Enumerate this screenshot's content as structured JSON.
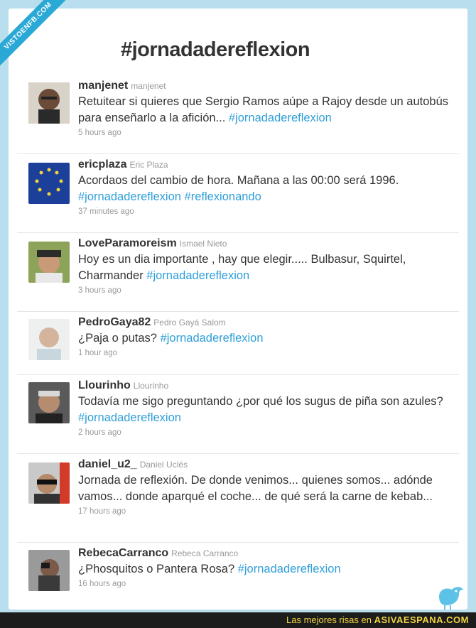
{
  "ribbon": "VISTOENFB.COM",
  "title": "#jornadadereflexion",
  "tweets": [
    {
      "user": "manjenet",
      "real": "manjenet",
      "text": "Retuitear si quieres que Sergio Ramos aúpe a Rajoy desde un autobús para enseñarlo a la afición... ",
      "tags": "#jornadadereflexion",
      "time": "5 hours ago"
    },
    {
      "user": "ericplaza",
      "real": "Eric Plaza",
      "text": "Acordaos del cambio de hora. Mañana a las 00:00 será 1996. ",
      "tags": "#jornadadereflexion #reflexionando",
      "time": "37 minutes ago"
    },
    {
      "user": "LoveParamoreism",
      "real": "Ismael Nieto",
      "text": "Hoy es un dia importante , hay que elegir..... Bulbasur, Squirtel, Charmander ",
      "tags": "#jornadadereflexion",
      "time": "3 hours ago"
    },
    {
      "user": "PedroGaya82",
      "real": "Pedro Gayá Salom",
      "text": "¿Paja o putas? ",
      "tags": "#jornadadereflexion",
      "time": "1 hour ago"
    },
    {
      "user": "Llourinho",
      "real": "Llourinho",
      "text": "Todavía me sigo preguntando ¿por qué los sugus de piña son azules? ",
      "tags": "#jornadadereflexion",
      "time": "2 hours ago"
    },
    {
      "user": "daniel_u2_",
      "real": "Daniel Uclés",
      "text": "Jornada de reflexión. De donde venimos... quienes somos... adónde vamos... donde aparqué el coche... de qué será la carne de kebab...",
      "tags": "",
      "time": "17 hours ago"
    },
    {
      "user": "RebecaCarranco",
      "real": "Rebeca Carranco",
      "text": "¿Phosquitos o Pantera Rosa? ",
      "tags": "#jornadadereflexion",
      "time": "16 hours ago"
    }
  ],
  "footer": {
    "prefix": "Las mejores risas en ",
    "brand": "ASIVAESPANA.COM"
  },
  "colors": {
    "accent": "#2f9fd8",
    "ribbon": "#2aa8d6",
    "background": "#b9dfee",
    "footer_bg": "#1c1c1c",
    "footer_text": "#f3d341"
  }
}
